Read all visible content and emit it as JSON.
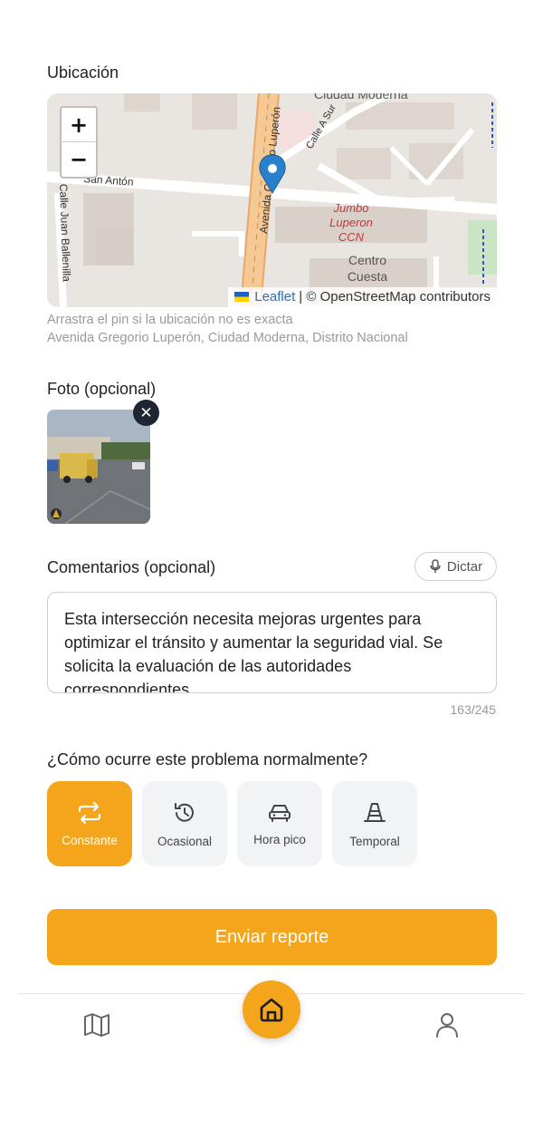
{
  "location": {
    "label": "Ubicación",
    "zoom_in": "+",
    "zoom_out": "−",
    "map_labels": {
      "street1": "Avenida Gregorio Luperón",
      "street2": "Calle A Sur",
      "street3": "Calle Juan Ballenilla",
      "street4": "San Antón",
      "area": "Ciudad Moderna",
      "poi1_line1": "Jumbo",
      "poi1_line2": "Luperon",
      "poi1_line3": "CCN",
      "poi2_line1": "Centro",
      "poi2_line2": "Cuesta"
    },
    "attribution_link": "Leaflet",
    "attribution_text": "| © OpenStreetMap contributors",
    "hint": "Arrastra el pin si la ubicación no es exacta",
    "address": "Avenida Gregorio Luperón, Ciudad Moderna, Distrito Nacional"
  },
  "photo": {
    "label": "Foto (opcional)",
    "remove": "✕"
  },
  "comments": {
    "label": "Comentarios (opcional)",
    "dictate_label": "Dictar",
    "text": "Esta intersección necesita mejoras urgentes para optimizar el tránsito y aumentar la seguridad vial. Se solicita la evaluación de las autoridades correspondientes.",
    "counter": "163/245"
  },
  "frequency": {
    "question": "¿Cómo ocurre este problema normalmente?",
    "options": [
      {
        "label": "Constante",
        "icon": "repeat-icon",
        "selected": true
      },
      {
        "label": "Ocasional",
        "icon": "history-icon",
        "selected": false
      },
      {
        "label": "Hora pico",
        "icon": "car-icon",
        "selected": false
      },
      {
        "label": "Temporal",
        "icon": "traffic-cone-icon",
        "selected": false
      }
    ]
  },
  "submit_label": "Enviar reporte",
  "nav": {
    "items": [
      "map-icon",
      "home-icon",
      "user-icon"
    ]
  },
  "colors": {
    "accent": "#f4a51c",
    "pin": "#2a81cb"
  }
}
